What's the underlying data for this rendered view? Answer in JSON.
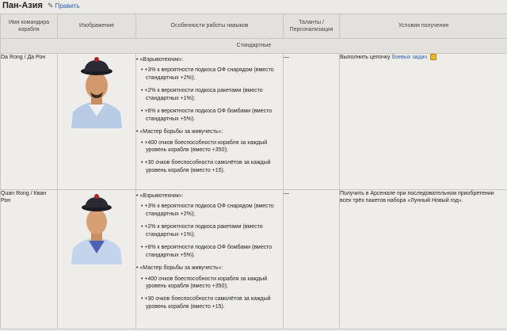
{
  "section": {
    "title": "Пан-Азия",
    "edit_label": "Править"
  },
  "table": {
    "headers": [
      "Имя командира корабля",
      "Изображение",
      "Особенности работы навыков",
      "Таланты / Персонализация",
      "Условия получения"
    ],
    "group_label": "Стандартные",
    "rows": [
      {
        "name": "Da Rong / Да Рон",
        "skills": [
          {
            "title": "«Взрывотехник»:",
            "effects": [
              "+3% к вероятности подкоса ОФ снарядом (вместо стандартных +2%);",
              "+2% к вероятности подкоса ракетами (вместо стандартных +1%);",
              "+6% к вероятности подкоса ОФ бомбами (вместо стандартных +5%)."
            ]
          },
          {
            "title": "«Мастер борьбы за живучесть»:",
            "effects": [
              "+400 очков боеспособности корабля за каждый уровень корабля (вместо +350);",
              "+30 очков боеспособности самолётов за каждый уровень корабля (вместо +15)."
            ]
          }
        ],
        "talents": "—",
        "condition_prefix": "Выполнить цепочку ",
        "condition_link": "боевых задач",
        "condition_suffix": ""
      },
      {
        "name": "Quan Rong / Кван Рон",
        "skills": [
          {
            "title": "«Взрывотехник»:",
            "effects": [
              "+3% к вероятности подкоса ОФ снарядом (вместо стандартных +2%);",
              "+2% к вероятности подкоса ракетами (вместо стандартных +1%);",
              "+6% к вероятности подкоса ОФ бомбами (вместо стандартных +5%)."
            ]
          },
          {
            "title": "«Мастер борьбы за живучесть»:",
            "effects": [
              "+400 очков боеспособности корабля за каждый уровень корабля (вместо +350);",
              "+30 очков боеспособности самолётов за каждый уровень корабля (вместо +15)."
            ]
          }
        ],
        "talents": "—",
        "condition_text": "Получить в Арсенале при последовательном приобретении всех трёх пакетов набора «Лунный Новый год»."
      }
    ]
  },
  "icons": {
    "edit": "pencil-icon",
    "task": "task-icon"
  }
}
